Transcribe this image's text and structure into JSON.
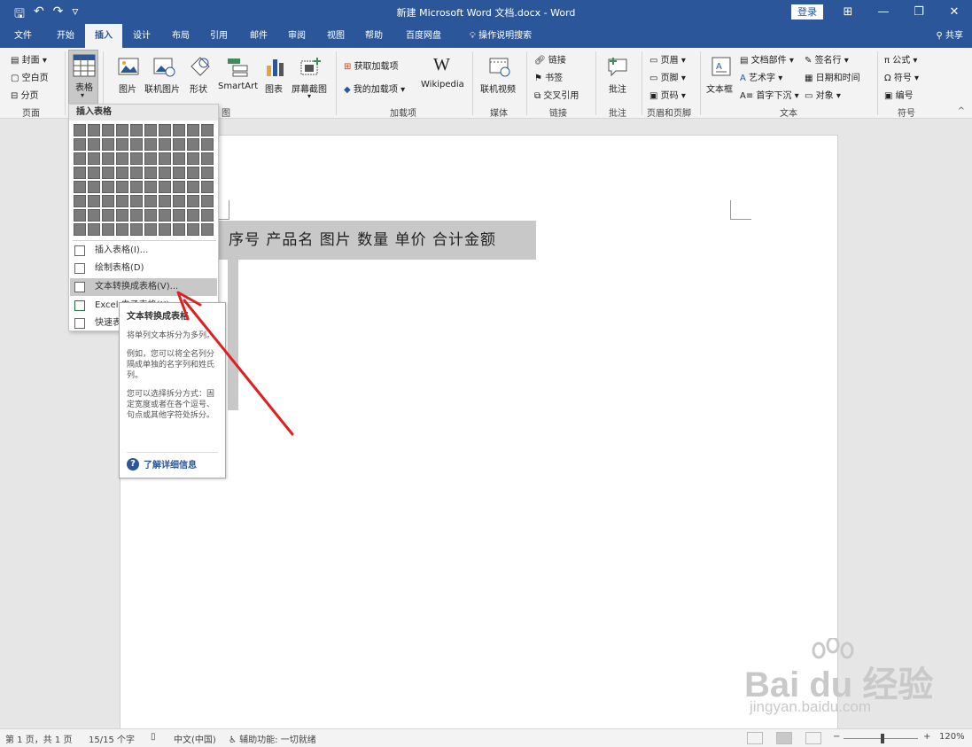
{
  "title_bar": {
    "qat": [
      "🖫",
      "↶",
      "↷",
      "▿"
    ],
    "document_title": "新建 Microsoft Word 文档.docx - Word",
    "login": "登录",
    "window_controls": [
      "⊞",
      "—",
      "❐",
      "✕"
    ]
  },
  "tabs": [
    {
      "label": "文件",
      "active": false
    },
    {
      "label": "开始",
      "active": false
    },
    {
      "label": "插入",
      "active": true
    },
    {
      "label": "设计",
      "active": false
    },
    {
      "label": "布局",
      "active": false
    },
    {
      "label": "引用",
      "active": false
    },
    {
      "label": "邮件",
      "active": false
    },
    {
      "label": "审阅",
      "active": false
    },
    {
      "label": "视图",
      "active": false
    },
    {
      "label": "帮助",
      "active": false
    },
    {
      "label": "百度网盘",
      "active": false
    },
    {
      "label": "操作说明搜索",
      "active": false
    }
  ],
  "share": "共享",
  "ribbon": {
    "pages": {
      "cover": "封面 ▾",
      "blank": "空白页",
      "break": "分页",
      "group": "页面"
    },
    "table": {
      "label": "表格",
      "caret": "▾"
    },
    "illustrations": {
      "picture": "图片",
      "online_picture": "联机图片",
      "shapes": "形状",
      "smartart": "SmartArt",
      "chart": "图表",
      "screenshot": "屏幕截图",
      "group_tail": "图"
    },
    "addins": {
      "get": "获取加载项",
      "my": "我的加载项",
      "wikipedia_logo": "W",
      "wikipedia": "Wikipedia",
      "group": "加载项"
    },
    "media": {
      "online_video": "联机视频",
      "group": "媒体"
    },
    "links": {
      "link": "链接",
      "bookmark": "书签",
      "cross_ref": "交叉引用",
      "group": "链接"
    },
    "comments": {
      "comment": "批注",
      "group": "批注"
    },
    "header_footer": {
      "header": "页眉 ▾",
      "footer": "页脚 ▾",
      "page_num": "页码 ▾",
      "group": "页眉和页脚"
    },
    "text": {
      "textbox": "文本框",
      "quick_parts": "文档部件 ▾",
      "wordart": "艺术字 ▾",
      "dropcap": "首字下沉 ▾",
      "signature": "签名行 ▾",
      "datetime": "日期和时间",
      "object": "对象 ▾",
      "group": "文本"
    },
    "symbols": {
      "equation": "π 公式 ▾",
      "symbol": "Ω 符号 ▾",
      "number": "编号",
      "group": "符号"
    },
    "collapse": "^"
  },
  "dropdown": {
    "header": "插入表格",
    "grid_rows": 8,
    "grid_cols": 10,
    "items": [
      {
        "label": "插入表格(I)...",
        "highlighted": false
      },
      {
        "label": "绘制表格(D)",
        "highlighted": false
      },
      {
        "label": "文本转换成表格(V)...",
        "highlighted": true
      },
      {
        "label": "Excel 电子表格(X)",
        "highlighted": false
      },
      {
        "label": "快速表格(T)",
        "highlighted": false
      }
    ]
  },
  "tooltip": {
    "title": "文本转换成表格",
    "p1": "将单列文本拆分为多列。",
    "p2": "例如，您可以将全名列分隔成单独的名字列和姓氏列。",
    "p3": "您可以选择拆分方式：固定宽度或者在各个逗号、句点或其他字符处拆分。",
    "link": "了解详细信息"
  },
  "document": {
    "selected_text": "序号 产品名 图片 数量 单价 合计金额"
  },
  "status_bar": {
    "page": "第 1 页，共 1 页",
    "words": "15/15 个字",
    "language": "中文(中国)",
    "accessibility": "辅助功能: 一切就绪",
    "zoom": "120%",
    "zoom_minus": "−",
    "zoom_plus": "+"
  },
  "watermark": {
    "brand": "Bai du 经验",
    "url": "jingyan.baidu.com"
  },
  "colors": {
    "accent": "#2b579a",
    "arrow": "#e02020"
  }
}
